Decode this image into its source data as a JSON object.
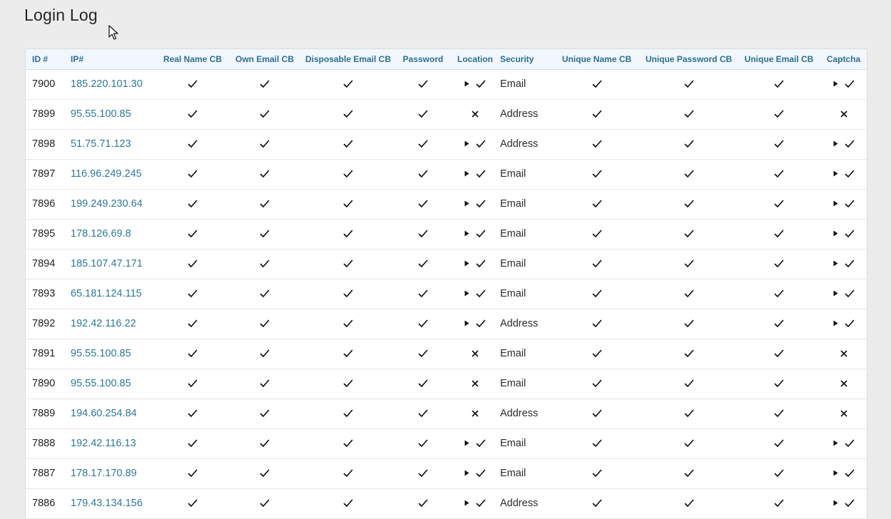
{
  "page": {
    "title": "Login Log"
  },
  "table": {
    "columns": [
      "ID #",
      "IP#",
      "Real Name CB",
      "Own Email CB",
      "Disposable Email CB",
      "Password",
      "Location",
      "Security",
      "Unique Name CB",
      "Unique Password CB",
      "Unique Email CB",
      "Captcha"
    ],
    "icons": {
      "check": "check-icon",
      "cross": "cross-icon",
      "expand": "play-icon"
    },
    "rows": [
      {
        "id": "7900",
        "ip": "185.220.101.30",
        "location": "pass",
        "security": "Email",
        "captcha": "pass"
      },
      {
        "id": "7899",
        "ip": "95.55.100.85",
        "location": "fail",
        "security": "Address",
        "captcha": "fail"
      },
      {
        "id": "7898",
        "ip": "51.75.71.123",
        "location": "pass",
        "security": "Address",
        "captcha": "pass"
      },
      {
        "id": "7897",
        "ip": "116.96.249.245",
        "location": "pass",
        "security": "Email",
        "captcha": "pass"
      },
      {
        "id": "7896",
        "ip": "199.249.230.64",
        "location": "pass",
        "security": "Email",
        "captcha": "pass"
      },
      {
        "id": "7895",
        "ip": "178.126.69.8",
        "location": "pass",
        "security": "Email",
        "captcha": "pass"
      },
      {
        "id": "7894",
        "ip": "185.107.47.171",
        "location": "pass",
        "security": "Email",
        "captcha": "pass"
      },
      {
        "id": "7893",
        "ip": "65.181.124.115",
        "location": "pass",
        "security": "Email",
        "captcha": "pass"
      },
      {
        "id": "7892",
        "ip": "192.42.116.22",
        "location": "pass",
        "security": "Address",
        "captcha": "pass"
      },
      {
        "id": "7891",
        "ip": "95.55.100.85",
        "location": "fail",
        "security": "Email",
        "captcha": "fail"
      },
      {
        "id": "7890",
        "ip": "95.55.100.85",
        "location": "fail",
        "security": "Email",
        "captcha": "fail"
      },
      {
        "id": "7889",
        "ip": "194.60.254.84",
        "location": "fail",
        "security": "Address",
        "captcha": "fail"
      },
      {
        "id": "7888",
        "ip": "192.42.116.13",
        "location": "pass",
        "security": "Email",
        "captcha": "pass"
      },
      {
        "id": "7887",
        "ip": "178.17.170.89",
        "location": "pass",
        "security": "Email",
        "captcha": "pass"
      },
      {
        "id": "7886",
        "ip": "179.43.134.156",
        "location": "pass",
        "security": "Address",
        "captcha": "pass"
      }
    ]
  }
}
